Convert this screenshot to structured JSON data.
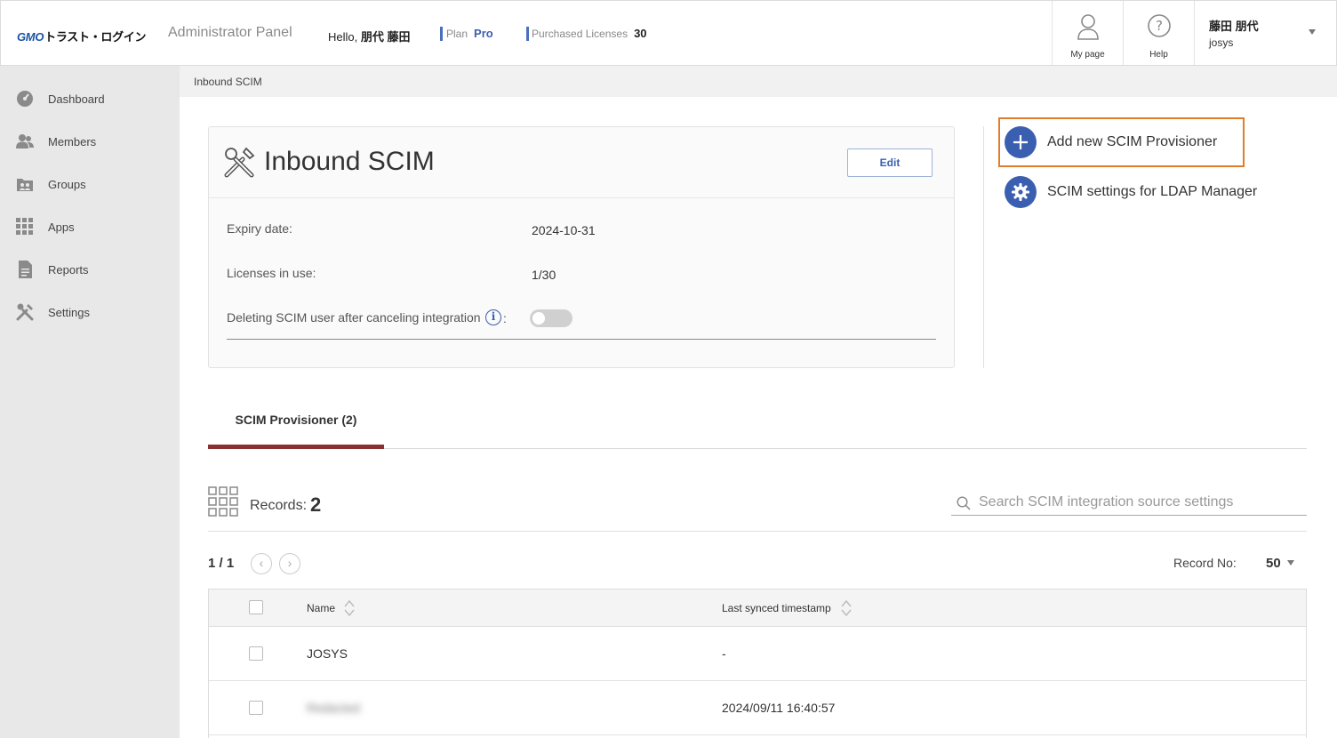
{
  "header": {
    "logo_brand": "GMO",
    "logo_text": "トラスト・ログイン",
    "panel_title": "Administrator Panel",
    "hello_prefix": "Hello,",
    "hello_name": "朋代 藤田",
    "plan_label": "Plan",
    "plan_value": "Pro",
    "licenses_label": "Purchased Licenses",
    "licenses_value": "30",
    "mypage_label": "My page",
    "help_label": "Help",
    "user_name": "藤田 朋代",
    "user_org": "josys"
  },
  "sidebar": {
    "items": [
      {
        "label": "Dashboard",
        "icon": "dashboard-icon"
      },
      {
        "label": "Members",
        "icon": "members-icon"
      },
      {
        "label": "Groups",
        "icon": "groups-icon"
      },
      {
        "label": "Apps",
        "icon": "apps-grid-icon"
      },
      {
        "label": "Reports",
        "icon": "report-document-icon"
      },
      {
        "label": "Settings",
        "icon": "wrench-screwdriver-icon"
      }
    ]
  },
  "breadcrumb": "Inbound SCIM",
  "card": {
    "title": "Inbound SCIM",
    "edit_label": "Edit",
    "expiry_label": "Expiry date:",
    "expiry_value": "2024-10-31",
    "licenses_label": "Licenses in use:",
    "licenses_value": "1/30",
    "deleting_label": "Deleting SCIM user after canceling integration",
    "deleting_colon": ":",
    "deleting_enabled": false
  },
  "actions": {
    "add_provisioner": "Add new SCIM Provisioner",
    "ldap_settings": "SCIM settings for LDAP Manager"
  },
  "tab": {
    "label": "SCIM Provisioner (2)"
  },
  "records": {
    "label": "Records:",
    "count": "2",
    "search_placeholder": "Search SCIM integration source settings"
  },
  "pager": {
    "text": "1 / 1",
    "prev": "‹",
    "next": "›",
    "record_no_label": "Record No:",
    "record_no_value": "50"
  },
  "table": {
    "columns": [
      "Name",
      "Last synced timestamp"
    ],
    "rows": [
      {
        "name": "JOSYS",
        "synced": "-"
      },
      {
        "name": "Redacted",
        "synced": "2024/09/11 16:40:57"
      }
    ]
  },
  "colors": {
    "accent": "#3b5fb0",
    "highlight": "#e07d2b",
    "tab_underline": "#8b3030",
    "sidebar_bg": "#e8e8e8"
  }
}
